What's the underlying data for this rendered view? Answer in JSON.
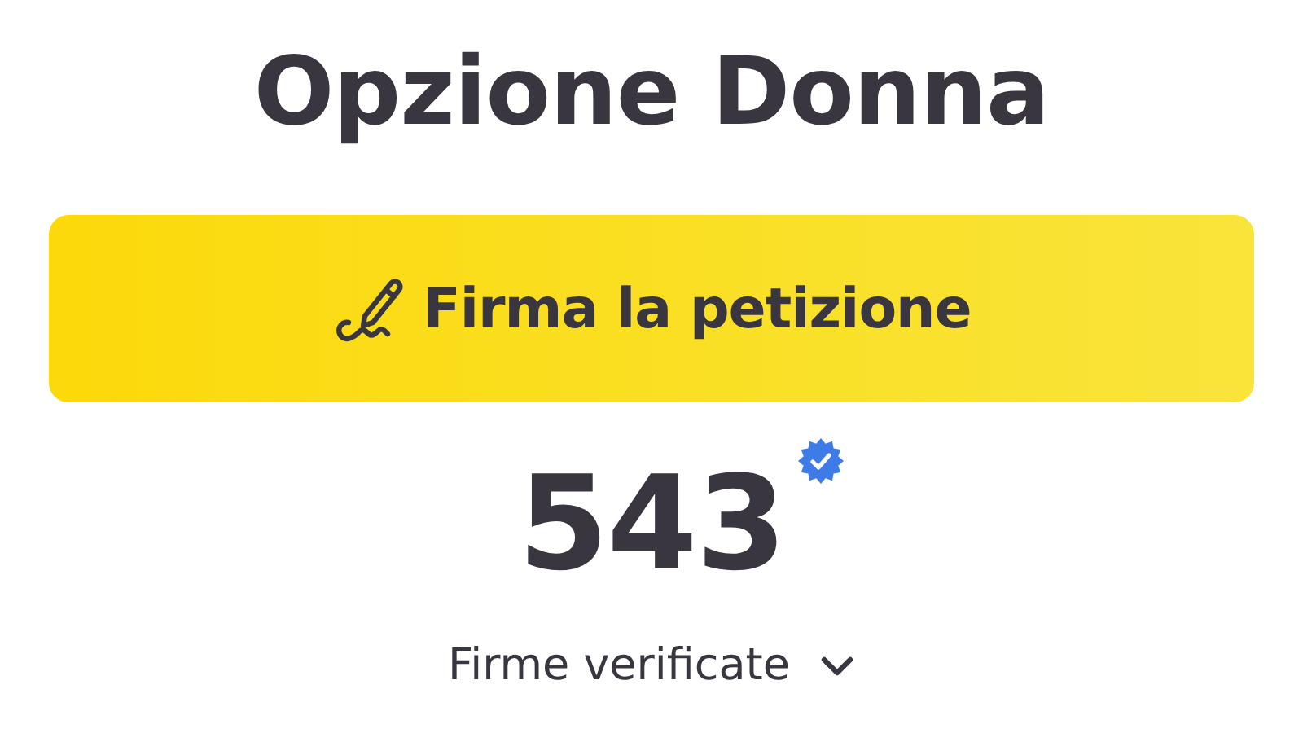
{
  "title": "Opzione Donna",
  "sign_button": {
    "label": "Firma la petizione"
  },
  "count": {
    "value": "543",
    "verified": true
  },
  "count_label": {
    "label": "Firme verificate",
    "expanded": false
  }
}
